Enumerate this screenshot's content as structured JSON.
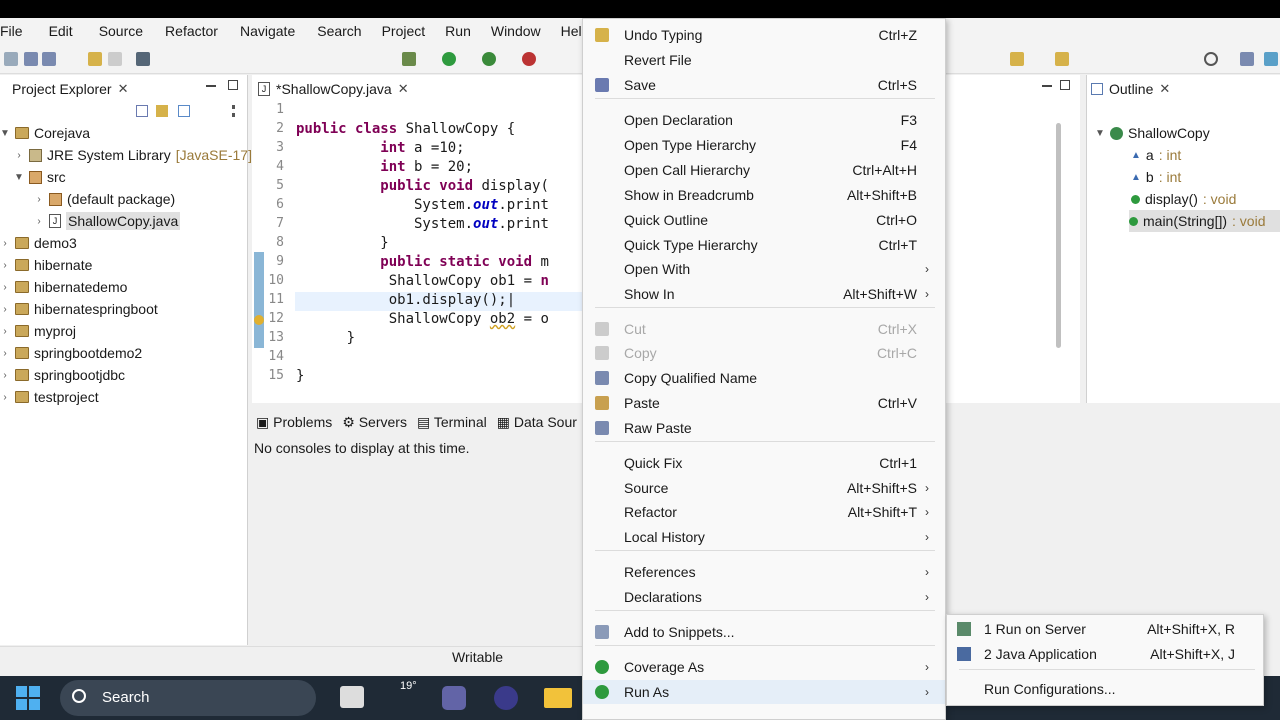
{
  "menubar": [
    "File",
    "Edit",
    "Source",
    "Refactor",
    "Navigate",
    "Search",
    "Project",
    "Run",
    "Window",
    "Help"
  ],
  "project_explorer": {
    "title": "Project Explorer",
    "items": [
      {
        "label": "Corejava",
        "decor": ""
      },
      {
        "label": "JRE System Library",
        "decor": "[JavaSE-17]"
      },
      {
        "label": "src",
        "decor": ""
      },
      {
        "label": "(default package)",
        "decor": ""
      },
      {
        "label": "ShallowCopy.java",
        "decor": ""
      },
      {
        "label": "demo3",
        "decor": ""
      },
      {
        "label": "hibernate",
        "decor": ""
      },
      {
        "label": "hibernatedemo",
        "decor": ""
      },
      {
        "label": "hibernatespringboot",
        "decor": ""
      },
      {
        "label": "myproj",
        "decor": ""
      },
      {
        "label": "springbootdemo2",
        "decor": ""
      },
      {
        "label": "springbootjdbc",
        "decor": ""
      },
      {
        "label": "testproject",
        "decor": ""
      }
    ]
  },
  "editor": {
    "tab": "*ShallowCopy.java",
    "line_numbers": [
      "1",
      "2",
      "3",
      "4",
      "5",
      "6",
      "7",
      "8",
      "9",
      "10",
      "11",
      "12",
      "13",
      "14",
      "15"
    ]
  },
  "outline": {
    "title": "Outline",
    "items": [
      {
        "label": "ShallowCopy",
        "type": ""
      },
      {
        "label": "a",
        "type": " : int"
      },
      {
        "label": "b",
        "type": " : int"
      },
      {
        "label": "display()",
        "type": " : void"
      },
      {
        "label": "main(String[])",
        "type": " : void"
      }
    ]
  },
  "bottom_panel": {
    "tabs": [
      "Problems",
      "Servers",
      "Terminal",
      "Data Sour"
    ],
    "message": "No consoles to display at this time."
  },
  "status": {
    "writable": "Writable"
  },
  "context_menu": {
    "items": [
      {
        "label": "Undo Typing",
        "shortcut": "Ctrl+Z"
      },
      {
        "label": "Revert File",
        "shortcut": ""
      },
      {
        "label": "Save",
        "shortcut": "Ctrl+S"
      },
      {
        "label": "Open Declaration",
        "shortcut": "F3"
      },
      {
        "label": "Open Type Hierarchy",
        "shortcut": "F4"
      },
      {
        "label": "Open Call Hierarchy",
        "shortcut": "Ctrl+Alt+H"
      },
      {
        "label": "Show in Breadcrumb",
        "shortcut": "Alt+Shift+B"
      },
      {
        "label": "Quick Outline",
        "shortcut": "Ctrl+O"
      },
      {
        "label": "Quick Type Hierarchy",
        "shortcut": "Ctrl+T"
      },
      {
        "label": "Open With",
        "shortcut": ""
      },
      {
        "label": "Show In",
        "shortcut": "Alt+Shift+W"
      },
      {
        "label": "Cut",
        "shortcut": "Ctrl+X"
      },
      {
        "label": "Copy",
        "shortcut": "Ctrl+C"
      },
      {
        "label": "Copy Qualified Name",
        "shortcut": ""
      },
      {
        "label": "Paste",
        "shortcut": "Ctrl+V"
      },
      {
        "label": "Raw Paste",
        "shortcut": ""
      },
      {
        "label": "Quick Fix",
        "shortcut": "Ctrl+1"
      },
      {
        "label": "Source",
        "shortcut": "Alt+Shift+S"
      },
      {
        "label": "Refactor",
        "shortcut": "Alt+Shift+T"
      },
      {
        "label": "Local History",
        "shortcut": ""
      },
      {
        "label": "References",
        "shortcut": ""
      },
      {
        "label": "Declarations",
        "shortcut": ""
      },
      {
        "label": "Add to Snippets...",
        "shortcut": ""
      },
      {
        "label": "Coverage As",
        "shortcut": ""
      },
      {
        "label": "Run As",
        "shortcut": ""
      }
    ]
  },
  "run_as_submenu": {
    "items": [
      {
        "label": "1 Run on Server",
        "shortcut": "Alt+Shift+X, R"
      },
      {
        "label": "2 Java Application",
        "shortcut": "Alt+Shift+X, J"
      },
      {
        "label": "Run Configurations...",
        "shortcut": ""
      }
    ]
  },
  "taskbar": {
    "search": "Search",
    "weather": "19°"
  },
  "colors": {
    "keyword": "#7f0055",
    "field": "#0000c0",
    "menu_bg": "#f9f9f9",
    "highlight": "#e5eef8"
  }
}
